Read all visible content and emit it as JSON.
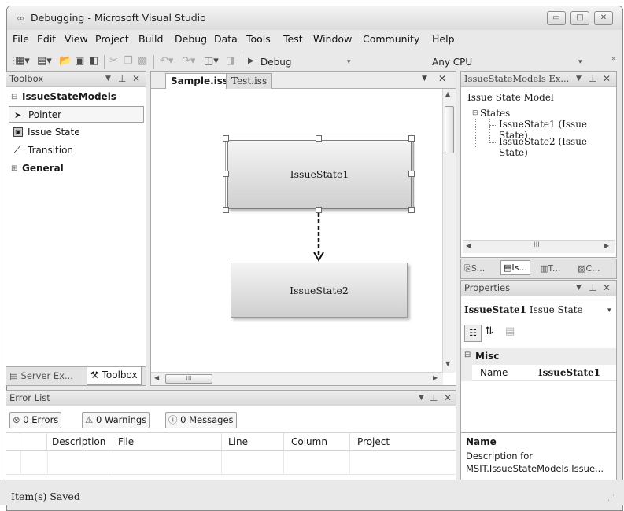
{
  "window": {
    "title": "Debugging - Microsoft Visual Studio",
    "app_icon": "∞",
    "minimize": "▭",
    "maximize": "□",
    "close": "✕"
  },
  "menu": [
    "File",
    "Edit",
    "View",
    "Project",
    "Build",
    "Debug",
    "Data",
    "Tools",
    "Test",
    "Window",
    "Community",
    "Help"
  ],
  "toolbar": {
    "config": "Debug",
    "platform": "Any CPU"
  },
  "toolbox": {
    "title": "Toolbox",
    "group_open": "IssueStateModels",
    "items": [
      "Pointer",
      "Issue State",
      "Transition"
    ],
    "group_closed": "General",
    "bottom_tabs": [
      "Server Ex...",
      "Toolbox"
    ]
  },
  "editor": {
    "tabs": [
      "Sample.iss",
      "Test.iss"
    ],
    "hscroll_thumb": "III",
    "states": [
      "IssueState1",
      "IssueState2"
    ]
  },
  "solution_explorer": {
    "title": "IssueStateModels Ex...",
    "root": "Issue State Model",
    "folder": "States",
    "children": [
      "IssueState1 (Issue State)",
      "IssueState2 (Issue State)"
    ],
    "hscroll_thumb": "III",
    "tabs": [
      "S...",
      "Is...",
      "T...",
      "C..."
    ]
  },
  "properties": {
    "title": "Properties",
    "object_name": "IssueState1",
    "object_type": "Issue State",
    "category": "Misc",
    "prop_name": "Name",
    "prop_value": "IssueState1",
    "desc_title": "Name",
    "desc_text1": "Description for",
    "desc_text2": "MSIT.IssueStateModels.Issue..."
  },
  "error_list": {
    "title": "Error List",
    "errors": "0 Errors",
    "warnings": "0 Warnings",
    "messages": "0 Messages",
    "columns": [
      "Description",
      "File",
      "Line",
      "Column",
      "Project"
    ]
  },
  "status": {
    "text": "Item(s) Saved"
  }
}
